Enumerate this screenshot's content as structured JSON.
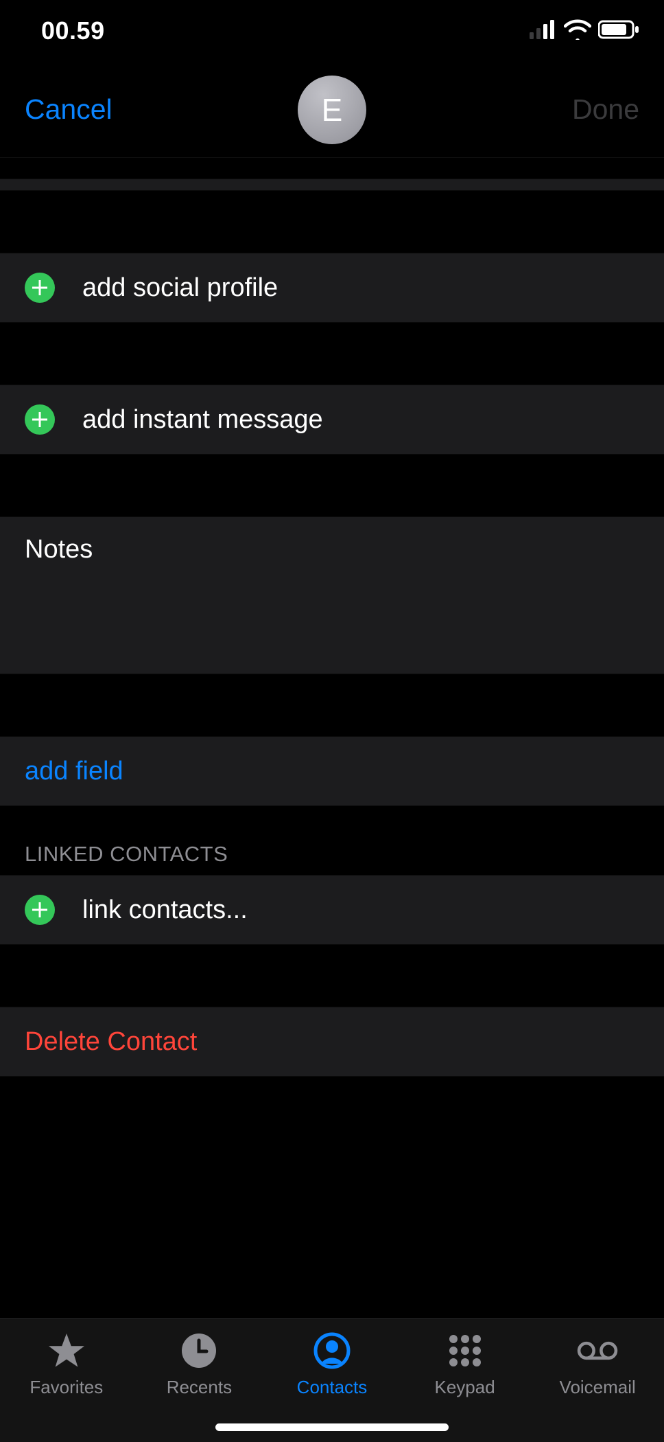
{
  "status": {
    "time": "00.59"
  },
  "nav": {
    "cancel": "Cancel",
    "done": "Done",
    "avatar_initial": "E"
  },
  "rows": {
    "add_social_profile": "add social profile",
    "add_instant_message": "add instant message",
    "notes_label": "Notes",
    "notes_value": "",
    "add_field": "add field",
    "link_contacts": "link contacts...",
    "delete_contact": "Delete Contact"
  },
  "sections": {
    "linked_contacts": "LINKED CONTACTS"
  },
  "tabs": {
    "favorites": "Favorites",
    "recents": "Recents",
    "contacts": "Contacts",
    "keypad": "Keypad",
    "voicemail": "Voicemail"
  },
  "colors": {
    "accent": "#0A84FF",
    "destructive": "#ff453a",
    "add_green": "#34c759",
    "row_bg": "#1c1c1e",
    "inactive": "#8e8e93"
  }
}
